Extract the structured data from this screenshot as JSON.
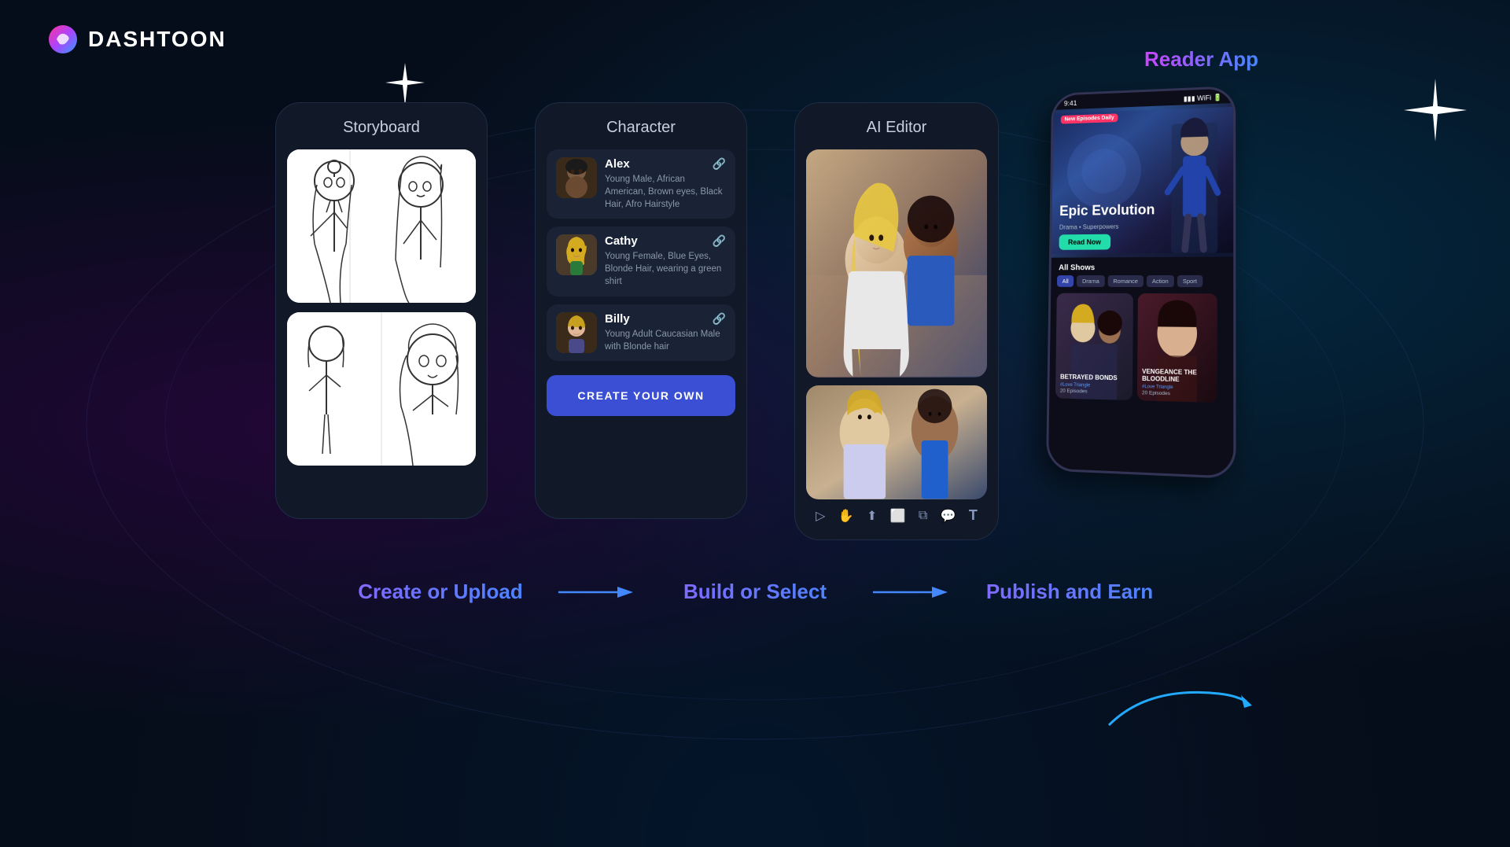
{
  "app": {
    "logo_text": "DASHTOON",
    "logo_icon": "D"
  },
  "storyboard": {
    "title": "Storyboard",
    "image1_alt": "storyboard sketch 1",
    "image2_alt": "storyboard sketch 2"
  },
  "character": {
    "title": "Character",
    "characters": [
      {
        "name": "Alex",
        "description": "Young Male, African American, Brown eyes, Black Hair, Afro Hairstyle",
        "avatar_bg": "#5a3a2a"
      },
      {
        "name": "Cathy",
        "description": "Young Female, Blue Eyes, Blonde Hair, wearing a green shirt",
        "avatar_bg": "#7a5a3a"
      },
      {
        "name": "Billy",
        "description": "Young Adult Caucasian Male with Blonde hair",
        "avatar_bg": "#6a5a4a"
      }
    ],
    "create_btn": "CREATE YOUR OWN"
  },
  "ai_editor": {
    "title": "AI Editor"
  },
  "reader_app": {
    "label": "Reader App",
    "show_badge": "New Episodes Daily",
    "show_title": "Epic Evolution",
    "show_subtitle": "Drama • Superpowers",
    "read_btn": "Read Now",
    "all_shows": "All Shows",
    "filters": [
      "All",
      "Drama",
      "Romance",
      "Action",
      "Sport"
    ],
    "show1_title": "BETRAYED BONDS",
    "show1_episodes": "20 Episodes",
    "show1_tag": "#Love Triangle",
    "show2_title": "VENGEANCE THE BLOODLINE",
    "show2_episodes": "20 Episodes",
    "show2_tag": "#Love Triangle"
  },
  "bottom": {
    "label1": "Create or Upload",
    "label2": "Build or Select",
    "label3": "Publish and Earn",
    "arrow1": "→",
    "arrow2": "→"
  }
}
